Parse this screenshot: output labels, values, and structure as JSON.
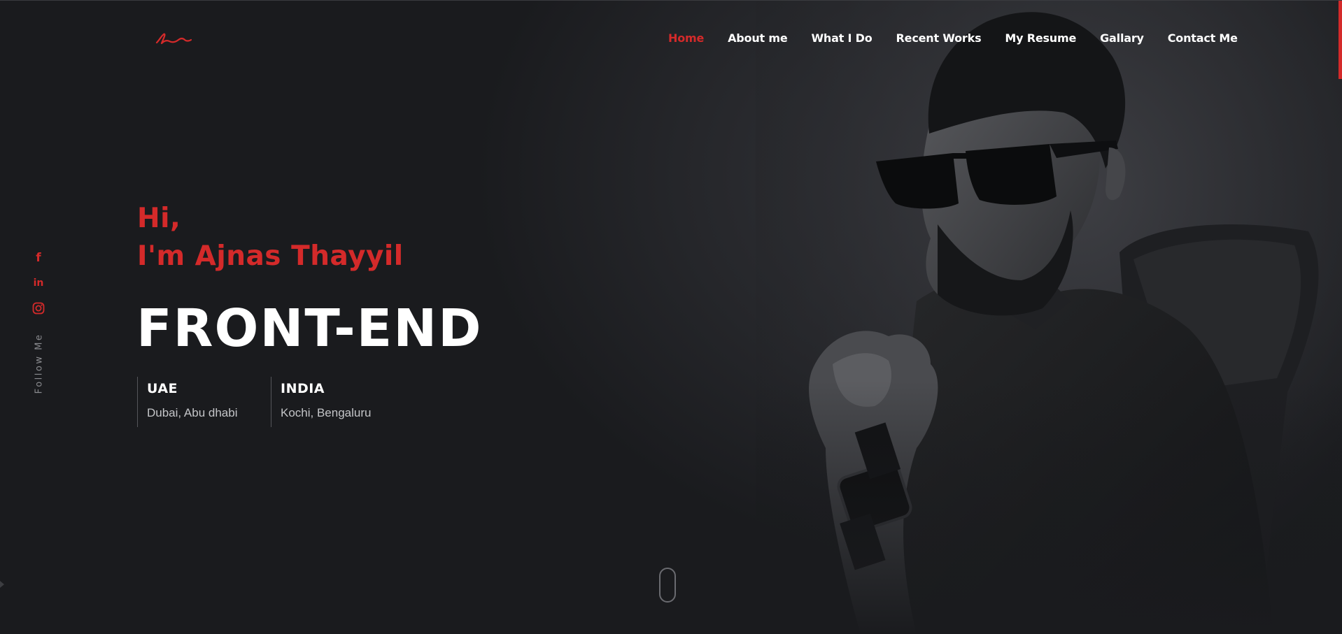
{
  "brand": {
    "logo_icon": "signature-logo-icon",
    "accent_color": "#d42a2a"
  },
  "nav": {
    "items": [
      {
        "label": "Home",
        "active": true
      },
      {
        "label": "About me"
      },
      {
        "label": "What I Do"
      },
      {
        "label": "Recent Works"
      },
      {
        "label": "My Resume"
      },
      {
        "label": "Gallary"
      },
      {
        "label": "Contact Me"
      }
    ]
  },
  "social": {
    "facebook": "f",
    "linkedin": "in",
    "instagram_icon": "instagram-icon",
    "follow_text": "Follow Me"
  },
  "hero": {
    "greeting_line1": "Hi,",
    "greeting_line2": "I'm Ajnas Thayyil",
    "role": "FRONT-END",
    "locations": [
      {
        "country": "UAE",
        "cities": "Dubai, Abu dhabi"
      },
      {
        "country": "INDIA",
        "cities": "Kochi, Bengaluru"
      }
    ],
    "portrait_icon": "portrait-image",
    "scroll_icon": "mouse-scroll-icon"
  }
}
